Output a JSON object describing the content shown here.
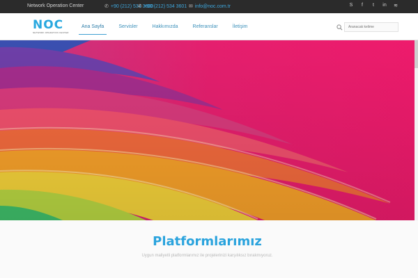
{
  "topbar": {
    "company": "Network Operation Center",
    "phone_1": "+90 (212) 534 3600",
    "phone_2": "+90 (212) 534 3601",
    "email": "info@noc.com.tr",
    "social": [
      {
        "name": "skype-icon",
        "glyph": "S"
      },
      {
        "name": "facebook-icon",
        "glyph": "f"
      },
      {
        "name": "twitter-icon",
        "glyph": "t"
      },
      {
        "name": "linkedin-icon",
        "glyph": "in"
      },
      {
        "name": "rss-icon",
        "glyph": "≋"
      }
    ]
  },
  "header": {
    "logo_text": "NOC",
    "logo_tagline": "NETWORK OPERATION CENTER",
    "nav": [
      {
        "label": "Ana Sayfa",
        "active": true
      },
      {
        "label": "Servisler",
        "active": false
      },
      {
        "label": "Hakkımızda",
        "active": false
      },
      {
        "label": "Referanslar",
        "active": false
      },
      {
        "label": "İletişim",
        "active": false
      }
    ],
    "search_placeholder": "Aranacak kelime"
  },
  "colors": {
    "accent": "#29a8df",
    "topbar_bg": "#2b2b2b"
  },
  "main": {
    "title": "Platformlarımız",
    "subtitle": "Uygun maliyetli platformlarımız ile projelerinizi karşılıksız bırakmıyoruz."
  }
}
